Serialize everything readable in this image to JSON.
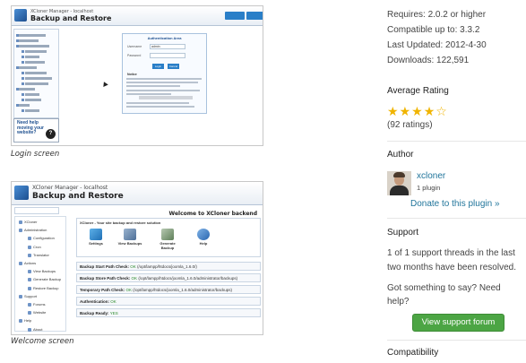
{
  "screenshots": [
    {
      "caption": "Login screen",
      "app_subtitle": "XCloner Manager - localhost",
      "app_title": "Backup and Restore",
      "login_title": "Authentication Area",
      "username_label": "Username",
      "username_value": "admin",
      "password_label": "Password",
      "button_labels": [
        "Login",
        "Cancel"
      ],
      "notice_title": "Notice",
      "help_text": "Need help moving your website?",
      "help_icon_glyph": "?"
    },
    {
      "caption": "Welcome screen",
      "app_subtitle": "XCloner Manager - localhost",
      "app_title": "Backup and Restore",
      "welcome": "Welcome to XCloner backend",
      "panel_title": "XCloner - Your site backup and restore solution",
      "icons": [
        "Settings",
        "View Backups",
        "Generate Backup",
        "Help"
      ],
      "menu": [
        {
          "label": "XCloner",
          "sub": false
        },
        {
          "label": "Administration",
          "sub": false
        },
        {
          "label": "Configuration",
          "sub": true
        },
        {
          "label": "Cron",
          "sub": true
        },
        {
          "label": "Translator",
          "sub": true
        },
        {
          "label": "Actions",
          "sub": false
        },
        {
          "label": "View Backups",
          "sub": true
        },
        {
          "label": "Generate Backup",
          "sub": true
        },
        {
          "label": "Restore Backup",
          "sub": true
        },
        {
          "label": "Support",
          "sub": false
        },
        {
          "label": "Forums",
          "sub": true
        },
        {
          "label": "Website",
          "sub": true
        },
        {
          "label": "Help",
          "sub": false
        },
        {
          "label": "About",
          "sub": true
        }
      ],
      "checks": [
        {
          "label": "Backup Start Path Check:",
          "status": "OK",
          "value": "(/opt/lampp/htdocs/joomla_1.6.0/)"
        },
        {
          "label": "Backup Store Path Check:",
          "status": "OK",
          "value": "(/opt/lampp/htdocs/joomla_1.6.0/administrator/backups)"
        },
        {
          "label": "Temporary Path Check:",
          "status": "OK",
          "value": "(/opt/lampp/htdocs/joomla_1.6.0/administrator/backups)"
        },
        {
          "label": "Authentication:",
          "status": "OK",
          "value": ""
        },
        {
          "label": "Backup Ready:",
          "status": "YES",
          "value": ""
        }
      ]
    }
  ],
  "meta": {
    "requires": "Requires: 2.0.2 or higher",
    "compatible": "Compatible up to: 3.3.2",
    "updated": "Last Updated: 2012-4-30",
    "downloads": "Downloads: 122,591"
  },
  "rating": {
    "title": "Average Rating",
    "stars": 4,
    "max": 5,
    "count_text": "(92 ratings)"
  },
  "author": {
    "title": "Author",
    "name": "xcloner",
    "plugins": "1 plugin",
    "donate": "Donate to this plugin »"
  },
  "support": {
    "title": "Support",
    "text": "1 of 1 support threads in the last two months have been resolved.",
    "prompt": "Got something to say? Need help?",
    "button": "View support forum"
  },
  "compatibility": {
    "title": "Compatibility"
  },
  "colors": {
    "link": "#21759b",
    "button_green": "#4ca544",
    "star": "#f0b400"
  }
}
